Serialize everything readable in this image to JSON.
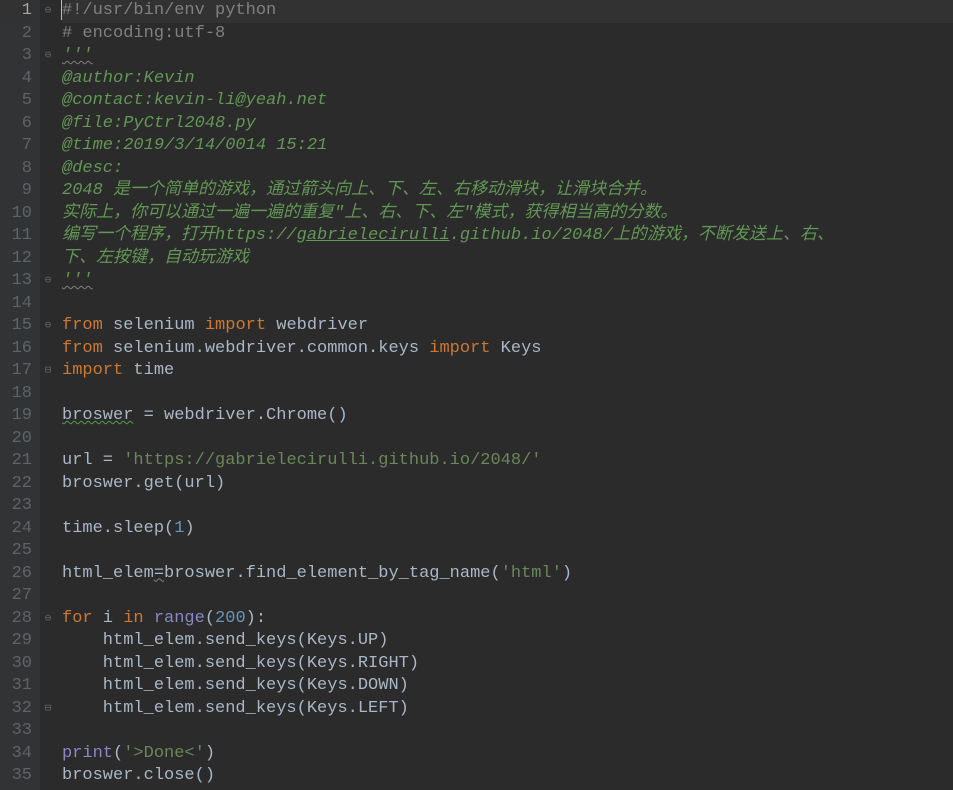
{
  "lines": [
    {
      "n": 1,
      "cls": "current",
      "fold": "⊖",
      "tokens": [
        {
          "t": "#",
          "c": "tok-comment",
          "caret": true
        },
        {
          "t": "!/usr/bin/env python",
          "c": "tok-comment"
        }
      ]
    },
    {
      "n": 2,
      "tokens": [
        {
          "t": "# encoding:utf-8",
          "c": "tok-comment"
        }
      ]
    },
    {
      "n": 3,
      "fold": "⊖",
      "tokens": [
        {
          "t": "'''",
          "c": "tok-docstring squiggle"
        }
      ]
    },
    {
      "n": 4,
      "tokens": [
        {
          "t": "@author:Kevin",
          "c": "tok-docstring"
        }
      ]
    },
    {
      "n": 5,
      "tokens": [
        {
          "t": "@contact:kevin-li@yeah.net",
          "c": "tok-docstring"
        }
      ]
    },
    {
      "n": 6,
      "tokens": [
        {
          "t": "@file:PyCtrl2048.py",
          "c": "tok-docstring"
        }
      ]
    },
    {
      "n": 7,
      "tokens": [
        {
          "t": "@time:2019/3/14/0014 15:21",
          "c": "tok-docstring"
        }
      ]
    },
    {
      "n": 8,
      "tokens": [
        {
          "t": "@desc:",
          "c": "tok-docstring"
        }
      ]
    },
    {
      "n": 9,
      "tokens": [
        {
          "t": "2048 是一个简单的游戏，通过箭头向上、下、左、右移动滑块，让滑块合并。",
          "c": "tok-docstring"
        }
      ]
    },
    {
      "n": 10,
      "tokens": [
        {
          "t": "实际上，你可以通过一遍一遍的重复\"上、右、下、左\"模式，获得相当高的分数。",
          "c": "tok-docstring"
        }
      ]
    },
    {
      "n": 11,
      "tokens": [
        {
          "t": "编写一个程序，打开",
          "c": "tok-docstring"
        },
        {
          "t": "https://",
          "c": "tok-docstring"
        },
        {
          "t": "gabrielecirulli",
          "c": "tok-docstring-link"
        },
        {
          "t": ".github.io/2048/",
          "c": "tok-docstring"
        },
        {
          "t": "上的游戏，不断发送上、右、",
          "c": "tok-docstring"
        }
      ]
    },
    {
      "n": 12,
      "tokens": [
        {
          "t": "下、左按键，自动玩游戏",
          "c": "tok-docstring"
        }
      ]
    },
    {
      "n": 13,
      "fold": "⊖",
      "tokens": [
        {
          "t": "'''",
          "c": "tok-docstring squiggle"
        }
      ]
    },
    {
      "n": 14,
      "tokens": [
        {
          "t": "",
          "c": "tok-default"
        }
      ]
    },
    {
      "n": 15,
      "fold": "⊖",
      "tokens": [
        {
          "t": "from",
          "c": "tok-keyword"
        },
        {
          "t": " selenium ",
          "c": "tok-default"
        },
        {
          "t": "import",
          "c": "tok-keyword"
        },
        {
          "t": " webdriver",
          "c": "tok-default"
        }
      ]
    },
    {
      "n": 16,
      "tokens": [
        {
          "t": "from",
          "c": "tok-keyword"
        },
        {
          "t": " selenium.webdriver.common.keys ",
          "c": "tok-default"
        },
        {
          "t": "import",
          "c": "tok-keyword"
        },
        {
          "t": " Keys",
          "c": "tok-default"
        }
      ]
    },
    {
      "n": 17,
      "fold": "⊟",
      "tokens": [
        {
          "t": "import",
          "c": "tok-keyword"
        },
        {
          "t": " time",
          "c": "tok-default"
        }
      ]
    },
    {
      "n": 18,
      "tokens": [
        {
          "t": "",
          "c": "tok-default"
        }
      ]
    },
    {
      "n": 19,
      "tokens": [
        {
          "t": "broswer",
          "c": "tok-default typo"
        },
        {
          "t": " = webdriver.Chrome()",
          "c": "tok-default"
        }
      ]
    },
    {
      "n": 20,
      "tokens": [
        {
          "t": "",
          "c": "tok-default"
        }
      ]
    },
    {
      "n": 21,
      "tokens": [
        {
          "t": "url = ",
          "c": "tok-default"
        },
        {
          "t": "'https://gabrielecirulli.github.io/2048/'",
          "c": "tok-string"
        }
      ]
    },
    {
      "n": 22,
      "tokens": [
        {
          "t": "broswer.get(url)",
          "c": "tok-default"
        }
      ]
    },
    {
      "n": 23,
      "tokens": [
        {
          "t": "",
          "c": "tok-default"
        }
      ]
    },
    {
      "n": 24,
      "tokens": [
        {
          "t": "time.sleep(",
          "c": "tok-default"
        },
        {
          "t": "1",
          "c": "tok-number"
        },
        {
          "t": ")",
          "c": "tok-default"
        }
      ]
    },
    {
      "n": 25,
      "tokens": [
        {
          "t": "",
          "c": "tok-default"
        }
      ]
    },
    {
      "n": 26,
      "tokens": [
        {
          "t": "html_elem",
          "c": "tok-default"
        },
        {
          "t": "=",
          "c": "tok-default squiggle"
        },
        {
          "t": "broswer.find_element_by_tag_name(",
          "c": "tok-default"
        },
        {
          "t": "'html'",
          "c": "tok-string"
        },
        {
          "t": ")",
          "c": "tok-default"
        }
      ]
    },
    {
      "n": 27,
      "tokens": [
        {
          "t": "",
          "c": "tok-default"
        }
      ]
    },
    {
      "n": 28,
      "fold": "⊖",
      "tokens": [
        {
          "t": "for",
          "c": "tok-keyword"
        },
        {
          "t": " i ",
          "c": "tok-default"
        },
        {
          "t": "in",
          "c": "tok-keyword"
        },
        {
          "t": " ",
          "c": "tok-default"
        },
        {
          "t": "range",
          "c": "tok-builtin"
        },
        {
          "t": "(",
          "c": "tok-default"
        },
        {
          "t": "200",
          "c": "tok-number"
        },
        {
          "t": "):",
          "c": "tok-default"
        }
      ]
    },
    {
      "n": 29,
      "tokens": [
        {
          "t": "    html_elem.send_keys(Keys.UP)",
          "c": "tok-default"
        }
      ]
    },
    {
      "n": 30,
      "tokens": [
        {
          "t": "    html_elem.send_keys(Keys.RIGHT)",
          "c": "tok-default"
        }
      ]
    },
    {
      "n": 31,
      "tokens": [
        {
          "t": "    html_elem.send_keys(Keys.DOWN)",
          "c": "tok-default"
        }
      ]
    },
    {
      "n": 32,
      "fold": "⊟",
      "tokens": [
        {
          "t": "    html_elem.send_keys(Keys.LEFT)",
          "c": "tok-default"
        }
      ]
    },
    {
      "n": 33,
      "tokens": [
        {
          "t": "",
          "c": "tok-default"
        }
      ]
    },
    {
      "n": 34,
      "tokens": [
        {
          "t": "print",
          "c": "tok-builtin"
        },
        {
          "t": "(",
          "c": "tok-default"
        },
        {
          "t": "'>Done<'",
          "c": "tok-string"
        },
        {
          "t": ")",
          "c": "tok-default"
        }
      ]
    },
    {
      "n": 35,
      "tokens": [
        {
          "t": "broswer.close()",
          "c": "tok-default"
        }
      ]
    }
  ]
}
